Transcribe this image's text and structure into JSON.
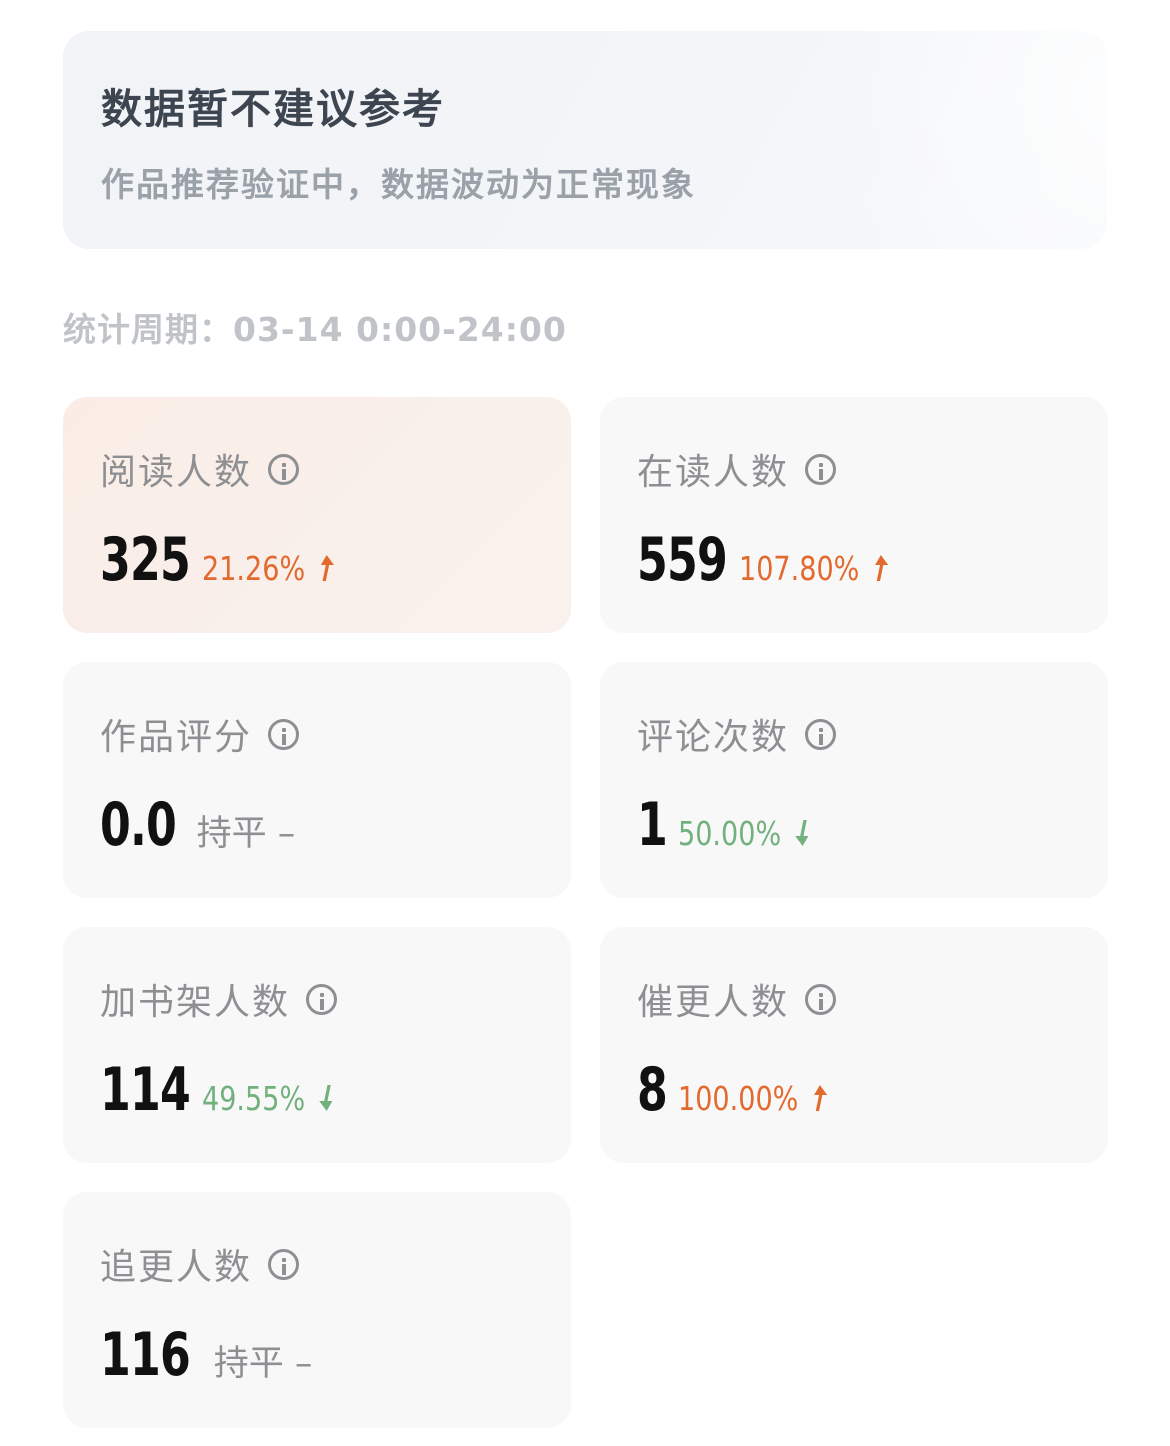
{
  "notice": {
    "title": "数据暂不建议参考",
    "desc": "作品推荐验证中，数据波动为正常现象"
  },
  "period": {
    "label": "统计周期：",
    "value": "03-14 0:00-24:00"
  },
  "cards": [
    {
      "label": "阅读人数",
      "value": "325",
      "change": "21.26%",
      "trend": "up",
      "icon": "info-icon"
    },
    {
      "label": "在读人数",
      "value": "559",
      "change": "107.80%",
      "trend": "up",
      "icon": "info-icon"
    },
    {
      "label": "作品评分",
      "value": "0.0",
      "change": "持平 –",
      "trend": "flat",
      "icon": "info-icon"
    },
    {
      "label": "评论次数",
      "value": "1",
      "change": "50.00%",
      "trend": "down",
      "icon": "info-icon"
    },
    {
      "label": "加书架人数",
      "value": "114",
      "change": "49.55%",
      "trend": "down",
      "icon": "info-icon"
    },
    {
      "label": "催更人数",
      "value": "8",
      "change": "100.00%",
      "trend": "up",
      "icon": "info-icon"
    },
    {
      "label": "追更人数",
      "value": "116",
      "change": "持平 –",
      "trend": "flat",
      "icon": "info-icon"
    }
  ],
  "colors": {
    "up": "#e36a2e",
    "down": "#72b17e",
    "flat": "#8e8f92"
  }
}
